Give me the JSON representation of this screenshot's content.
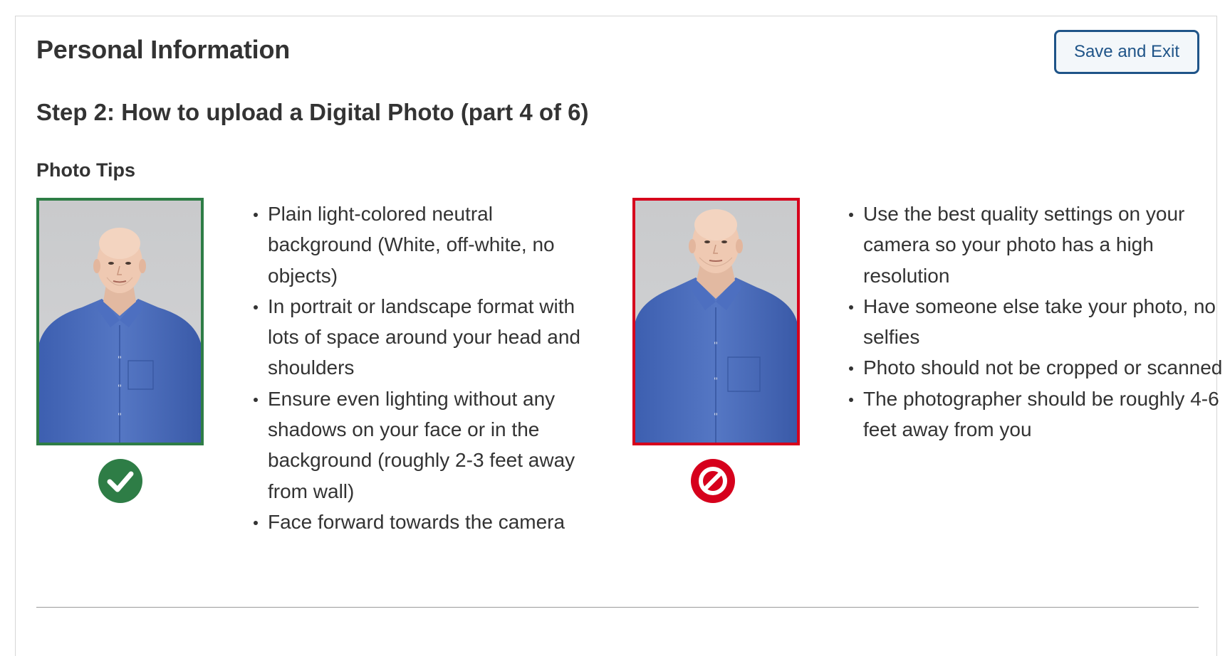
{
  "header": {
    "title": "Personal Information",
    "save_exit_label": "Save and Exit"
  },
  "step": {
    "title": "Step 2: How to upload a Digital Photo (part 4 of 6)"
  },
  "tips": {
    "heading": "Photo Tips",
    "left_list": [
      "Plain light-colored neutral background (White, off-white, no objects)",
      "In portrait or landscape format with lots of space around your head and shoulders",
      "Ensure even lighting without any shadows on your face or in the background (roughly 2-3 feet away from wall)",
      "Face forward towards the camera"
    ],
    "right_list": [
      "Use the best quality settings on your camera so your photo has a high resolution",
      "Have someone else take your photo, no selfies",
      "Photo should not be cropped or scanned",
      "The photographer should be roughly 4-6 feet away from you"
    ]
  },
  "examples": {
    "good": {
      "icon": "check-circle-icon",
      "frame_color": "#2e7d46"
    },
    "bad": {
      "icon": "prohibited-icon",
      "frame_color": "#d6001c"
    }
  },
  "colors": {
    "heading_text": "#333333",
    "button_border": "#1f5488",
    "button_bg": "#f3f7fa",
    "good_green": "#2e7d46",
    "bad_red": "#d6001c"
  }
}
